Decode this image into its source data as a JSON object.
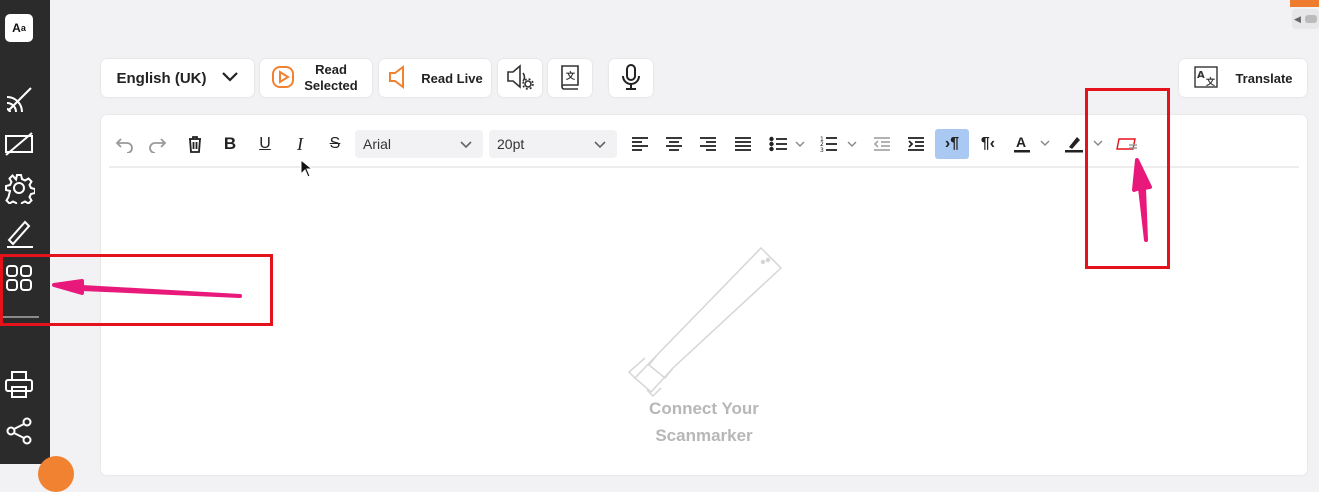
{
  "toolbar": {
    "language": "English (UK)",
    "read_selected": "Read Selected",
    "read_live": "Read Live",
    "translate": "Translate"
  },
  "format": {
    "font": "Arial",
    "size": "20pt"
  },
  "editor": {
    "placeholder_line1": "Connect Your",
    "placeholder_line2": "Scanmarker"
  },
  "colors": {
    "accent": "#f08232",
    "annotation_red": "#e3121b",
    "annotation_arrow": "#e8197a",
    "sidebar": "#2b2b2b"
  },
  "icons": {
    "sidebar": [
      "scan-icon",
      "no-image-icon",
      "settings-gear-icon",
      "pen-icon",
      "apps-grid-icon",
      "printer-icon",
      "share-icon"
    ],
    "format": [
      "undo-icon",
      "redo-icon",
      "trash-icon",
      "bold-icon",
      "underline-icon",
      "italic-icon",
      "strikethrough-icon",
      "align-left-icon",
      "align-center-icon",
      "align-right-icon",
      "justify-icon",
      "bullet-list-icon",
      "numbered-list-icon",
      "outdent-icon",
      "indent-icon",
      "ltr-icon",
      "rtl-icon",
      "font-color-icon",
      "highlight-icon",
      "clear-format-icon"
    ]
  }
}
